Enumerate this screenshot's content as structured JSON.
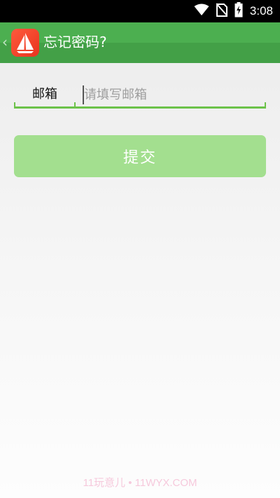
{
  "status_bar": {
    "time": "3:08",
    "icons": [
      "wifi-icon",
      "no-sim-icon",
      "battery-charging-icon"
    ]
  },
  "app_bar": {
    "back_icon": "back-chevron-icon",
    "logo_icon": "sailboat-logo-icon",
    "title": "忘记密码?"
  },
  "form": {
    "email_label": "邮箱",
    "email_value": "",
    "email_placeholder": "请填写邮箱",
    "submit_label": "提交"
  },
  "watermark": "11玩意儿 • 11WYX.COM",
  "colors": {
    "app_bar": "#4caf50",
    "accent_line": "#6cc24a",
    "submit_button": "#a3df8f",
    "logo": "#f04a2c"
  }
}
